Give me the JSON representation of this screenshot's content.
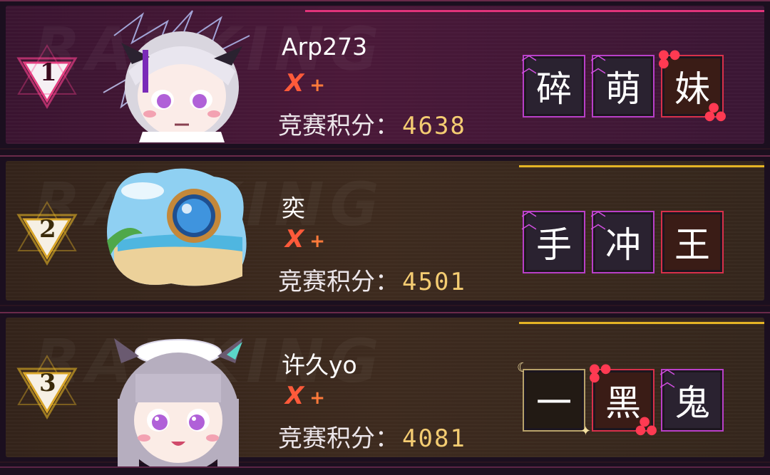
{
  "players": [
    {
      "rank": "1",
      "name": "Arp273",
      "badge": "X",
      "plus": "+",
      "score_label": "竞赛积分：",
      "score": "4638",
      "title_chars": [
        "碎",
        "萌",
        "妹"
      ],
      "tile_styles": [
        "purple",
        "purple",
        "red"
      ],
      "theme": "magenta"
    },
    {
      "rank": "2",
      "name": "奕",
      "badge": "X",
      "plus": "+",
      "score_label": "竞赛积分：",
      "score": "4501",
      "title_chars": [
        "手",
        "冲",
        "王"
      ],
      "tile_styles": [
        "purple",
        "purple",
        "red"
      ],
      "theme": "gold"
    },
    {
      "rank": "3",
      "name": "许久yo",
      "badge": "X",
      "plus": "+",
      "score_label": "竞赛积分：",
      "score": "4081",
      "title_chars": [
        "一",
        "黑",
        "鬼"
      ],
      "tile_styles": [
        "gold",
        "red",
        "purple"
      ],
      "theme": "gold"
    }
  ],
  "colors": {
    "magenta_accent": "#e0347a",
    "gold_accent": "#e5b425",
    "score_value": "#f4cc72",
    "x_badge": "#ff5a3a"
  },
  "icons": {
    "rank": "triangle-rank-icon",
    "avatar1": "white-haired-girl-avatar",
    "avatar2": "beach-orb-avatar",
    "avatar3": "maid-catgirl-avatar"
  }
}
